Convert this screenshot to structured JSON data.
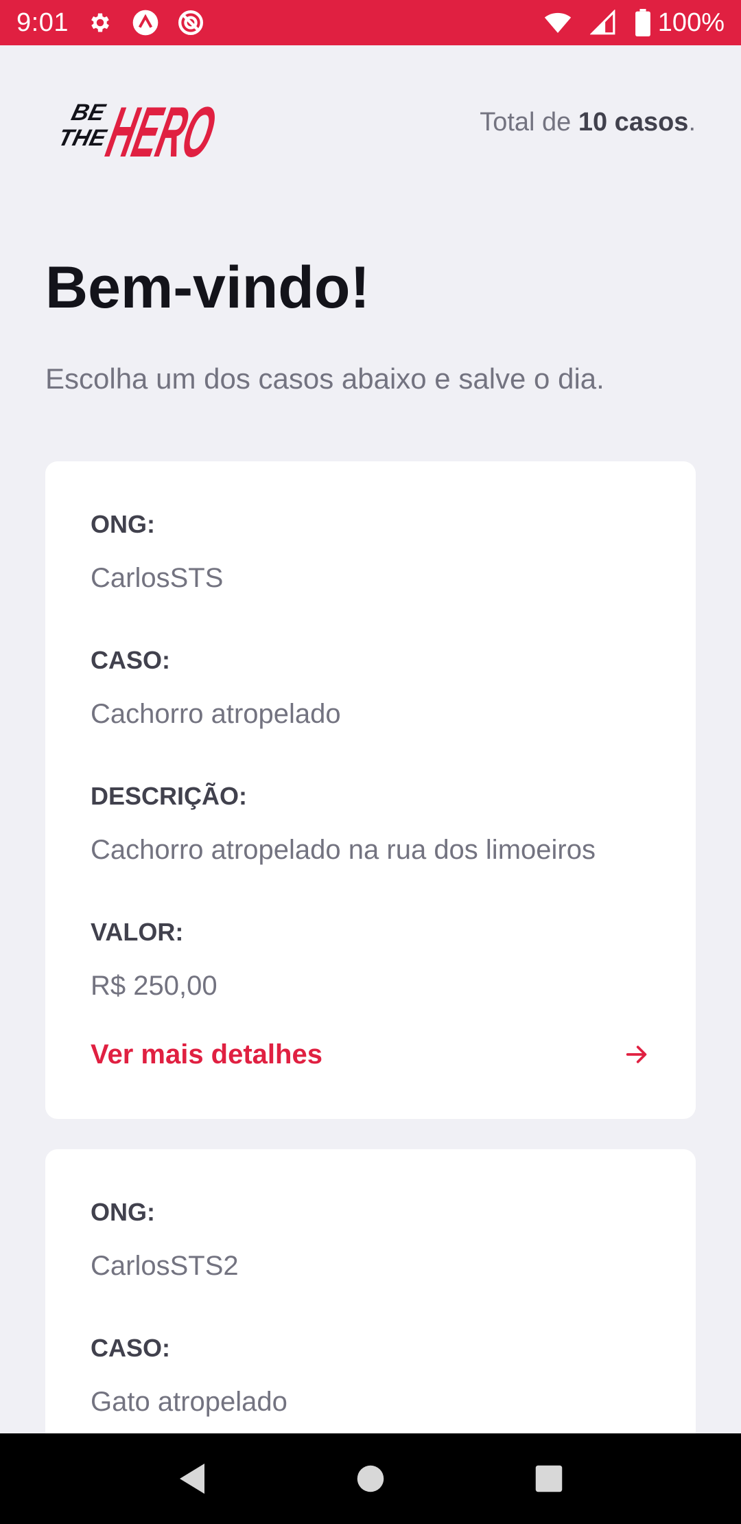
{
  "status_bar": {
    "time": "9:01",
    "battery": "100%",
    "left_icons": [
      "gear-icon",
      "app-badge-icon",
      "sync-icon"
    ],
    "right_icons": [
      "wifi-icon",
      "signal-icon",
      "battery-icon"
    ]
  },
  "header": {
    "logo_alt": "BE THE HERO",
    "total_prefix": "Total de ",
    "total_count": "10 casos",
    "total_suffix": "."
  },
  "title": "Bem-vindo!",
  "subtitle": "Escolha um dos casos abaixo e salve o dia.",
  "incidents": [
    {
      "ong_label": "ONG:",
      "ong": "CarlosSTS",
      "case_label": "CASO:",
      "case": "Cachorro atropelado",
      "description_label": "DESCRIÇÃO:",
      "description": "Cachorro atropelado na rua dos limoeiros",
      "value_label": "VALOR:",
      "value": "R$ 250,00",
      "details_label": "Ver mais detalhes"
    },
    {
      "ong_label": "ONG:",
      "ong": "CarlosSTS2",
      "case_label": "CASO:",
      "case": "Gato atropelado"
    }
  ],
  "colors": {
    "accent": "#e02041",
    "background": "#f0f0f5",
    "card": "#ffffff",
    "heading": "#13131a",
    "label": "#41414d",
    "text": "#737380"
  }
}
